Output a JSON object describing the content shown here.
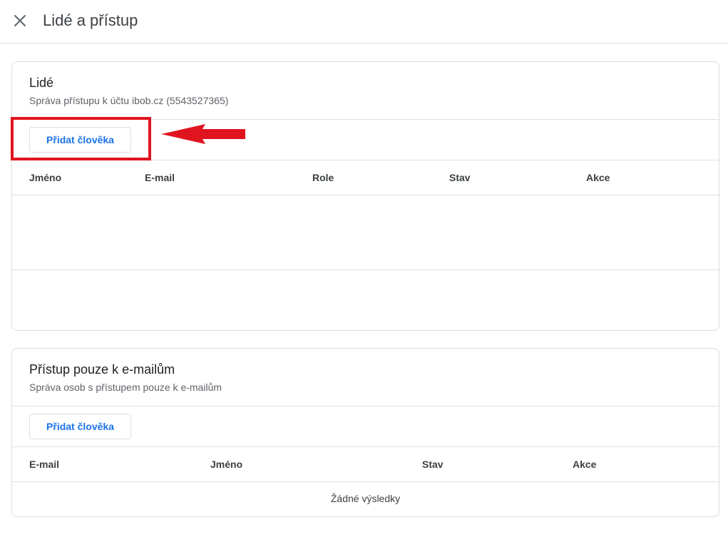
{
  "header": {
    "title": "Lidé a přístup",
    "close_icon": "close-icon"
  },
  "people_card": {
    "title": "Lidé",
    "subtitle": "Správa přístupu k účtu ibob.cz (5543527365)",
    "add_button_label": "Přidat člověka",
    "columns": [
      "Jméno",
      "E-mail",
      "Role",
      "Stav",
      "Akce"
    ],
    "rows": []
  },
  "email_card": {
    "title": "Přístup pouze k e-mailům",
    "subtitle": "Správa osob s přístupem pouze k e-mailům",
    "add_button_label": "Přidat člověka",
    "columns": [
      "E-mail",
      "Jméno",
      "Stav",
      "Akce"
    ],
    "empty_text": "Žádné výsledky"
  },
  "annotation": {
    "highlight_color": "#e0141f",
    "arrow_color": "#e0141f"
  },
  "colors": {
    "accent": "#1a73e8",
    "border": "#dadce0",
    "text_primary": "#202124",
    "text_secondary": "#5f6368"
  }
}
